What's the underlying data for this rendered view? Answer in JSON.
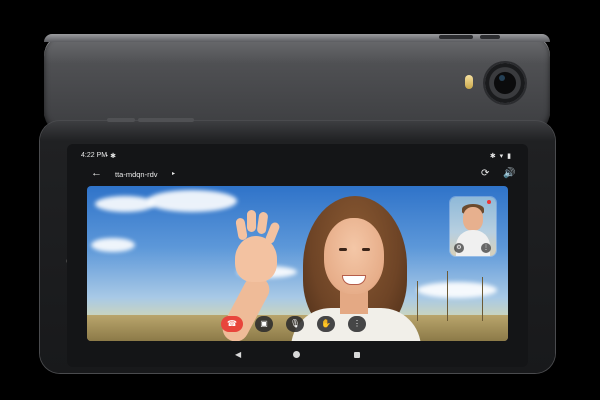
{
  "status_bar": {
    "time": "4:22 PM",
    "left_icons": "◔ ✱",
    "right_icons": "✱ ▾ ▮"
  },
  "app_bar": {
    "meeting_code": "tta-mdqn-rdv",
    "caret": "▸",
    "back_icon": "←",
    "switch_camera_icon": "⟳",
    "speaker_icon": "🔊"
  },
  "self_view": {
    "buttons": [
      "⚙",
      "⋮"
    ]
  },
  "controls": [
    {
      "name": "end-call",
      "icon": "☎"
    },
    {
      "name": "camera",
      "icon": "▣"
    },
    {
      "name": "microphone",
      "icon": "🎙"
    },
    {
      "name": "raise-hand",
      "icon": "✋"
    },
    {
      "name": "more",
      "icon": "⋮"
    }
  ],
  "nav_bar": {
    "back": "◀"
  },
  "colors": {
    "end_call": "#e8453c",
    "tablet_body": "#202123",
    "sky": "#5d98d9"
  }
}
